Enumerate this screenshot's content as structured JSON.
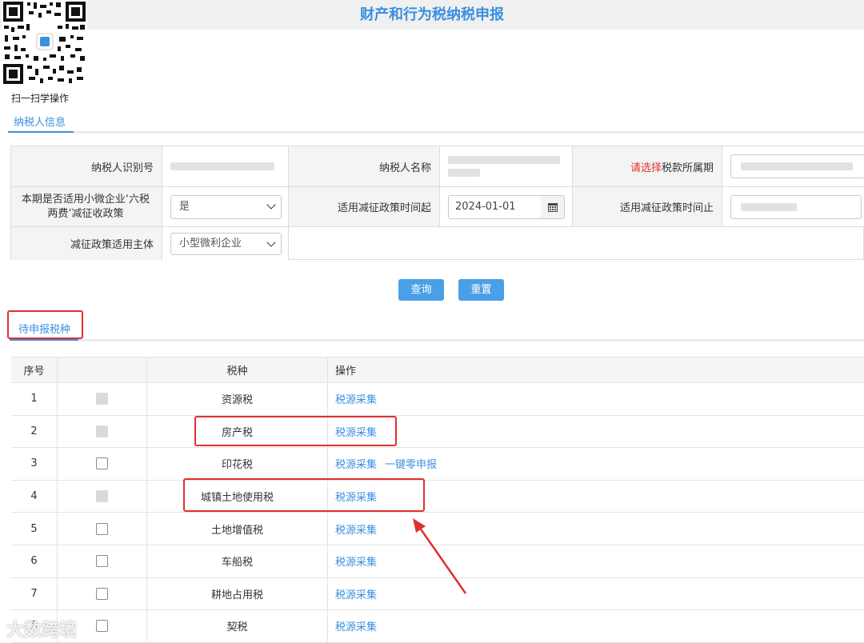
{
  "header": {
    "title": "财产和行为税纳税申报"
  },
  "qr": {
    "caption": "扫一扫学操作"
  },
  "taxpayer_tab": {
    "label": "纳税人信息"
  },
  "form": {
    "taxpayer_id_label": "纳税人识别号",
    "taxpayer_name_label": "纳税人名称",
    "period_label_prefix": "请选择",
    "period_label_suffix": "税款所属期",
    "small_micro_label": "本期是否适用小微企业‘六税两费’减征收政策",
    "small_micro_value": "是",
    "policy_start_label": "适用减征政策时间起",
    "policy_start_value": "2024-01-01",
    "policy_end_label": "适用减征政策时间止",
    "subject_label": "减征政策适用主体",
    "subject_value": "小型微利企业"
  },
  "buttons": {
    "query": "查询",
    "reset": "重置"
  },
  "pending_tab": {
    "label": "待申报税种"
  },
  "table": {
    "headers": {
      "no": "序号",
      "tax": "税种",
      "op": "操作"
    },
    "rows": [
      {
        "no": "1",
        "tax": "资源税",
        "op1": "税源采集",
        "op2": "",
        "checkbox": "disabled"
      },
      {
        "no": "2",
        "tax": "房产税",
        "op1": "税源采集",
        "op2": "",
        "checkbox": "disabled"
      },
      {
        "no": "3",
        "tax": "印花税",
        "op1": "税源采集",
        "op2": "一键零申报",
        "checkbox": "enabled"
      },
      {
        "no": "4",
        "tax": "城镇土地使用税",
        "op1": "税源采集",
        "op2": "",
        "checkbox": "disabled"
      },
      {
        "no": "5",
        "tax": "土地增值税",
        "op1": "税源采集",
        "op2": "",
        "checkbox": "enabled"
      },
      {
        "no": "6",
        "tax": "车船税",
        "op1": "税源采集",
        "op2": "",
        "checkbox": "enabled"
      },
      {
        "no": "7",
        "tax": "耕地占用税",
        "op1": "税源采集",
        "op2": "",
        "checkbox": "enabled"
      },
      {
        "no": "8",
        "tax": "契税",
        "op1": "税源采集",
        "op2": "",
        "checkbox": "enabled"
      }
    ]
  },
  "watermark": {
    "text": "大数跨境"
  },
  "colors": {
    "accent": "#3b8fe0",
    "button": "#4aa0e6",
    "highlight_red": "#e03030"
  }
}
